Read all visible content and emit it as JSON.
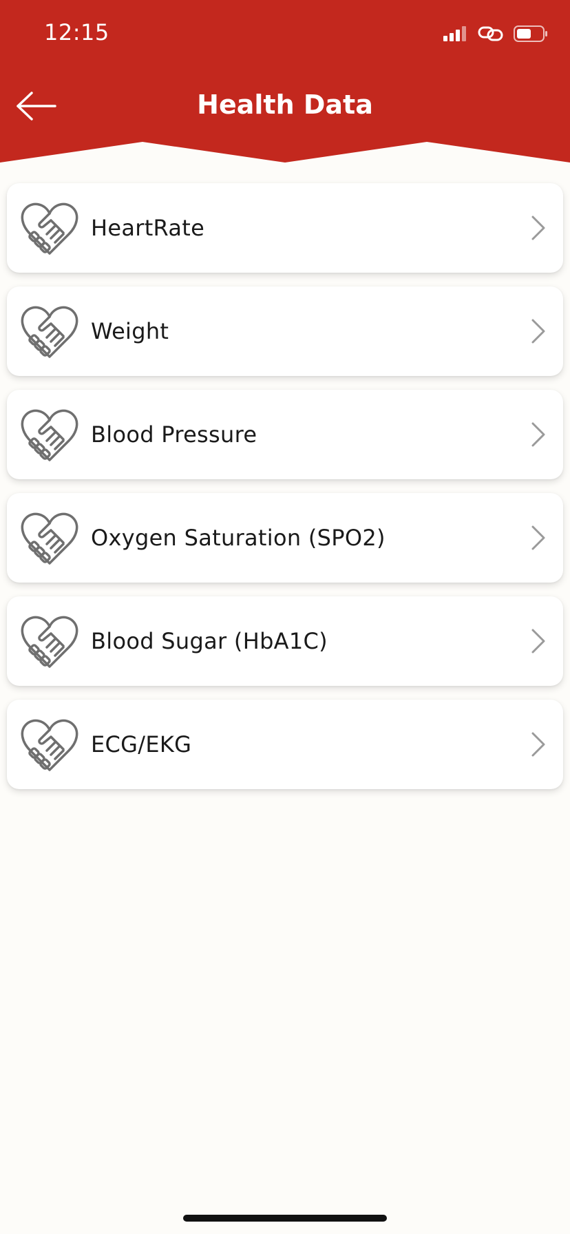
{
  "status_bar": {
    "time": "12:15",
    "signal_icon": "cellular-signal-icon",
    "link_icon": "link-icon",
    "battery_icon": "battery-icon"
  },
  "header": {
    "title": "Health Data",
    "back_icon": "arrow-left-icon",
    "background_color": "#c3281e"
  },
  "items": [
    {
      "label": "HeartRate",
      "icon": "heart-handshake-icon"
    },
    {
      "label": "Weight",
      "icon": "heart-handshake-icon"
    },
    {
      "label": "Blood Pressure",
      "icon": "heart-handshake-icon"
    },
    {
      "label": "Oxygen Saturation (SPO2)",
      "icon": "heart-handshake-icon"
    },
    {
      "label": "Blood Sugar (HbA1C)",
      "icon": "heart-handshake-icon"
    },
    {
      "label": "ECG/EKG",
      "icon": "heart-handshake-icon"
    }
  ],
  "colors": {
    "accent": "#c3281e",
    "page_background": "#fdfcf9",
    "icon_gray": "#6f6f6f"
  }
}
